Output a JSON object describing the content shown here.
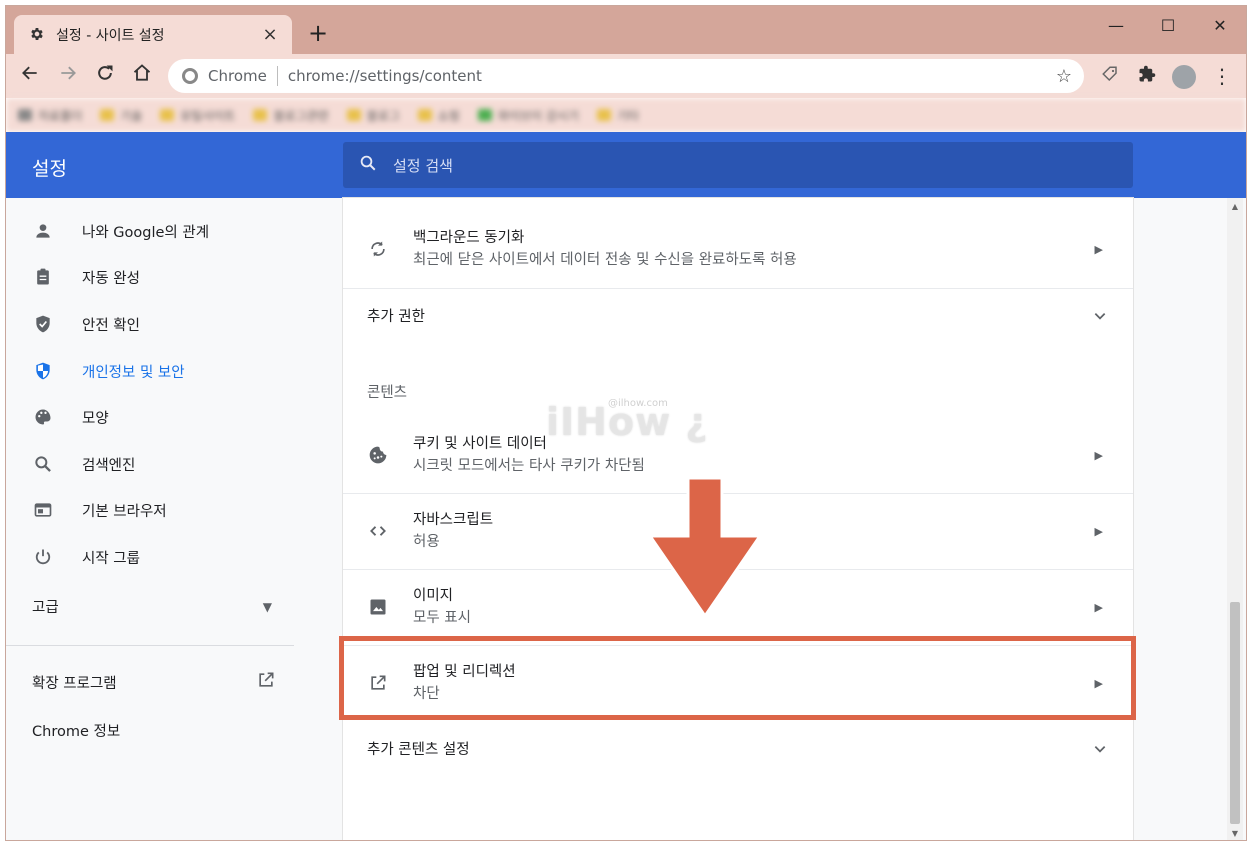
{
  "browser": {
    "tab": {
      "title": "설정 - 사이트 설정",
      "icon": "gear-icon"
    },
    "new_tab_symbol": "+",
    "window_controls": {
      "minimize": "—",
      "maximize": "☐",
      "close": "✕"
    },
    "omnibox": {
      "site": "Chrome",
      "url": "chrome://settings/content"
    },
    "bookmarks": [
      "자료폴더",
      "기술",
      "유틸사이트",
      "블로그관련",
      "블로그",
      "쇼핑",
      "와이브이 강시기",
      "기타"
    ]
  },
  "settings": {
    "header_title": "설정",
    "search_placeholder": "설정 검색",
    "sidebar": {
      "items": [
        {
          "label": "나와 Google의 관계",
          "icon": "person-icon",
          "active": false
        },
        {
          "label": "자동 완성",
          "icon": "clipboard-icon",
          "active": false
        },
        {
          "label": "안전 확인",
          "icon": "shield-check-icon",
          "active": false
        },
        {
          "label": "개인정보 및 보안",
          "icon": "shield-privacy-icon",
          "active": true
        },
        {
          "label": "모양",
          "icon": "palette-icon",
          "active": false
        },
        {
          "label": "검색엔진",
          "icon": "search-icon",
          "active": false
        },
        {
          "label": "기본 브라우저",
          "icon": "browser-window-icon",
          "active": false
        },
        {
          "label": "시작 그룹",
          "icon": "power-icon",
          "active": false
        }
      ],
      "advanced_label": "고급",
      "extensions_label": "확장 프로그램",
      "about_label": "Chrome 정보"
    },
    "content": {
      "background_sync": {
        "title": "백그라운드 동기화",
        "subtitle": "최근에 닫은 사이트에서 데이터 전송 및 수신을 완료하도록 허용"
      },
      "additional_permissions": "추가 권한",
      "contents_section": "콘텐츠",
      "rows": [
        {
          "title": "쿠키 및 사이트 데이터",
          "subtitle": "시크릿 모드에서는 타사 쿠키가 차단됨",
          "icon": "cookie-icon"
        },
        {
          "title": "자바스크립트",
          "subtitle": "허용",
          "icon": "code-icon"
        },
        {
          "title": "이미지",
          "subtitle": "모두 표시",
          "icon": "image-icon"
        },
        {
          "title": "팝업 및 리디렉션",
          "subtitle": "차단",
          "icon": "open-external-icon"
        }
      ],
      "additional_content_settings": "추가 콘텐츠 설정"
    }
  },
  "watermark": {
    "text": "iIHow ¿",
    "small": "@ilhow.com"
  },
  "colors": {
    "header_blue": "#3367d6",
    "active_blue": "#1a73e8",
    "annotation": "#dc6548",
    "titlebar": "#d4a69a"
  }
}
